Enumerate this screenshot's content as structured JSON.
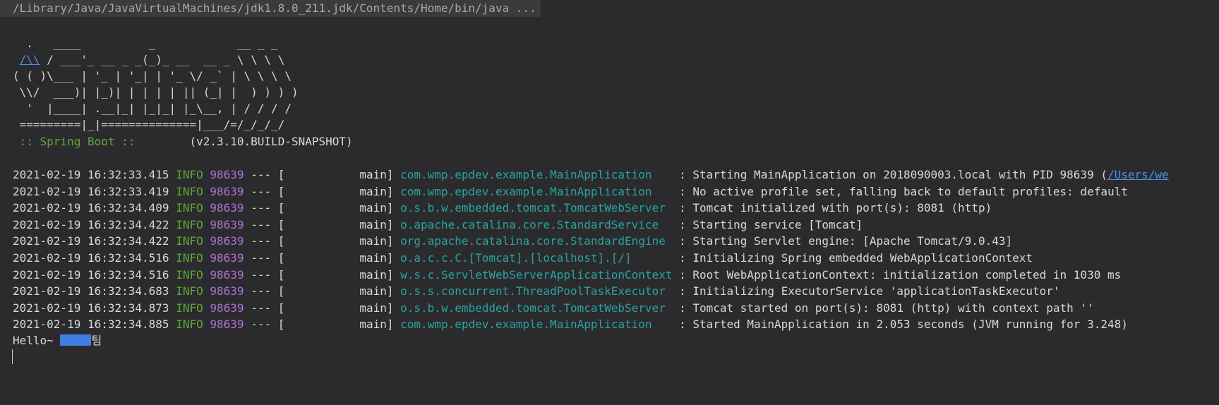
{
  "command": "/Library/Java/JavaVirtualMachines/jdk1.8.0_211.jdk/Contents/Home/bin/java ...",
  "banner": {
    "art": [
      "  .   ____          _            __ _ _",
      " /\\\\ / ___'_ __ _ _(_)_ __  __ _ \\ \\ \\ \\",
      "( ( )\\___ | '_ | '_| | '_ \\/ _` | \\ \\ \\ \\",
      " \\\\/  ___)| |_)| | | | | || (_| |  ) ) ) )",
      "  '  |____| .__|_| |_|_| |_\\__, | / / / /",
      " =========|_|==============|___/=/_/_/_/"
    ],
    "line1_rest": " / ___'_ __ _ _(_)_ __  __ _ \\ \\ \\ \\",
    "line1_link": "/\\\\",
    "spring_tag": " :: Spring Boot :: ",
    "version": "       (v2.3.10.BUILD-SNAPSHOT)"
  },
  "logs": [
    {
      "ts": "2021-02-19 16:32:33.415",
      "level": "INFO",
      "pid": "98639",
      "sep": "---",
      "thread": "[           main]",
      "logger": "com.wmp.epdev.example.MainApplication   ",
      "msg": ": Starting MainApplication on 2018090003.local with PID 98639 (",
      "link": "/Users/we"
    },
    {
      "ts": "2021-02-19 16:32:33.419",
      "level": "INFO",
      "pid": "98639",
      "sep": "---",
      "thread": "[           main]",
      "logger": "com.wmp.epdev.example.MainApplication   ",
      "msg": ": No active profile set, falling back to default profiles: default"
    },
    {
      "ts": "2021-02-19 16:32:34.409",
      "level": "INFO",
      "pid": "98639",
      "sep": "---",
      "thread": "[           main]",
      "logger": "o.s.b.w.embedded.tomcat.TomcatWebServer ",
      "msg": ": Tomcat initialized with port(s): 8081 (http)"
    },
    {
      "ts": "2021-02-19 16:32:34.422",
      "level": "INFO",
      "pid": "98639",
      "sep": "---",
      "thread": "[           main]",
      "logger": "o.apache.catalina.core.StandardService  ",
      "msg": ": Starting service [Tomcat]"
    },
    {
      "ts": "2021-02-19 16:32:34.422",
      "level": "INFO",
      "pid": "98639",
      "sep": "---",
      "thread": "[           main]",
      "logger": "org.apache.catalina.core.StandardEngine ",
      "msg": ": Starting Servlet engine: [Apache Tomcat/9.0.43]"
    },
    {
      "ts": "2021-02-19 16:32:34.516",
      "level": "INFO",
      "pid": "98639",
      "sep": "---",
      "thread": "[           main]",
      "logger": "o.a.c.c.C.[Tomcat].[localhost].[/]      ",
      "msg": ": Initializing Spring embedded WebApplicationContext"
    },
    {
      "ts": "2021-02-19 16:32:34.516",
      "level": "INFO",
      "pid": "98639",
      "sep": "---",
      "thread": "[           main]",
      "logger": "w.s.c.ServletWebServerApplicationContext",
      "msg": ": Root WebApplicationContext: initialization completed in 1030 ms"
    },
    {
      "ts": "2021-02-19 16:32:34.683",
      "level": "INFO",
      "pid": "98639",
      "sep": "---",
      "thread": "[           main]",
      "logger": "o.s.s.concurrent.ThreadPoolTaskExecutor ",
      "msg": ": Initializing ExecutorService 'applicationTaskExecutor'"
    },
    {
      "ts": "2021-02-19 16:32:34.873",
      "level": "INFO",
      "pid": "98639",
      "sep": "---",
      "thread": "[           main]",
      "logger": "o.s.b.w.embedded.tomcat.TomcatWebServer ",
      "msg": ": Tomcat started on port(s): 8081 (http) with context path ''"
    },
    {
      "ts": "2021-02-19 16:32:34.885",
      "level": "INFO",
      "pid": "98639",
      "sep": "---",
      "thread": "[           main]",
      "logger": "com.wmp.epdev.example.MainApplication   ",
      "msg": ": Started MainApplication in 2.053 seconds (JVM running for 3.248)"
    }
  ],
  "output": {
    "prefix": "Hello~ ",
    "suffix": "팀"
  }
}
